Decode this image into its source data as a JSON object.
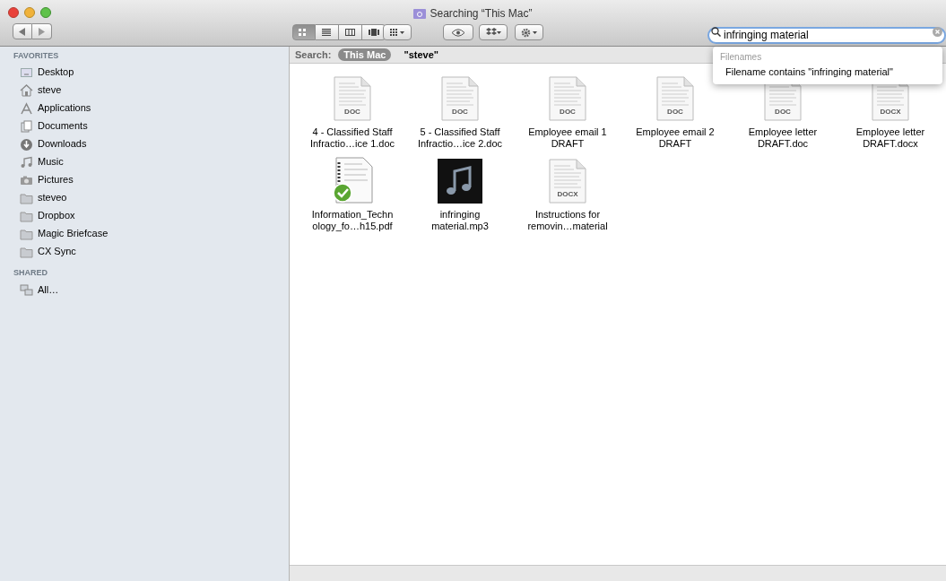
{
  "window": {
    "title": "Searching “This Mac”"
  },
  "toolbar": {
    "view_modes": [
      {
        "kind": "icon",
        "selected": true
      },
      {
        "kind": "list",
        "selected": false
      },
      {
        "kind": "columns",
        "selected": false
      },
      {
        "kind": "coverflow",
        "selected": false
      }
    ]
  },
  "search": {
    "value": "infringing material"
  },
  "suggestions": {
    "heading": "Filenames",
    "items": [
      "Filename contains \"infringing material\""
    ]
  },
  "sidebar": {
    "sections": [
      {
        "title": "FAVORITES",
        "items": [
          {
            "label": "Desktop",
            "kind": "desktop"
          },
          {
            "label": "steve",
            "kind": "home"
          },
          {
            "label": "Applications",
            "kind": "apps"
          },
          {
            "label": "Documents",
            "kind": "documents"
          },
          {
            "label": "Downloads",
            "kind": "downloads"
          },
          {
            "label": "Music",
            "kind": "music"
          },
          {
            "label": "Pictures",
            "kind": "pictures"
          },
          {
            "label": "steveo",
            "kind": "folder"
          },
          {
            "label": "Dropbox",
            "kind": "folder"
          },
          {
            "label": "Magic Briefcase",
            "kind": "folder"
          },
          {
            "label": "CX Sync",
            "kind": "folder"
          }
        ]
      },
      {
        "title": "SHARED",
        "items": [
          {
            "label": "All…",
            "kind": "network"
          }
        ]
      }
    ]
  },
  "scope_bar": {
    "label": "Search:",
    "scopes": [
      {
        "label": "This Mac",
        "selected": true
      },
      {
        "label": "\"steve\"",
        "selected": false
      }
    ]
  },
  "files": [
    {
      "name": "4 - Classified Staff Infractio…ice 1.doc",
      "kind": "doc",
      "badge": "DOC"
    },
    {
      "name": "5 - Classified Staff Infractio…ice 2.doc",
      "kind": "doc",
      "badge": "DOC"
    },
    {
      "name": "Employee email 1 DRAFT",
      "kind": "doc",
      "badge": "DOC"
    },
    {
      "name": "Employee email 2 DRAFT",
      "kind": "doc",
      "badge": "DOC"
    },
    {
      "name": "Employee letter DRAFT.doc",
      "kind": "doc",
      "badge": "DOC"
    },
    {
      "name": "Employee letter DRAFT.docx",
      "kind": "doc",
      "badge": "DOCX"
    },
    {
      "name": "Information_Techn ology_fo…h15.pdf",
      "kind": "pdf"
    },
    {
      "name": "infringing material.mp3",
      "kind": "audio"
    },
    {
      "name": "Instructions for removin…material",
      "kind": "doc",
      "badge": "DOCX"
    }
  ]
}
